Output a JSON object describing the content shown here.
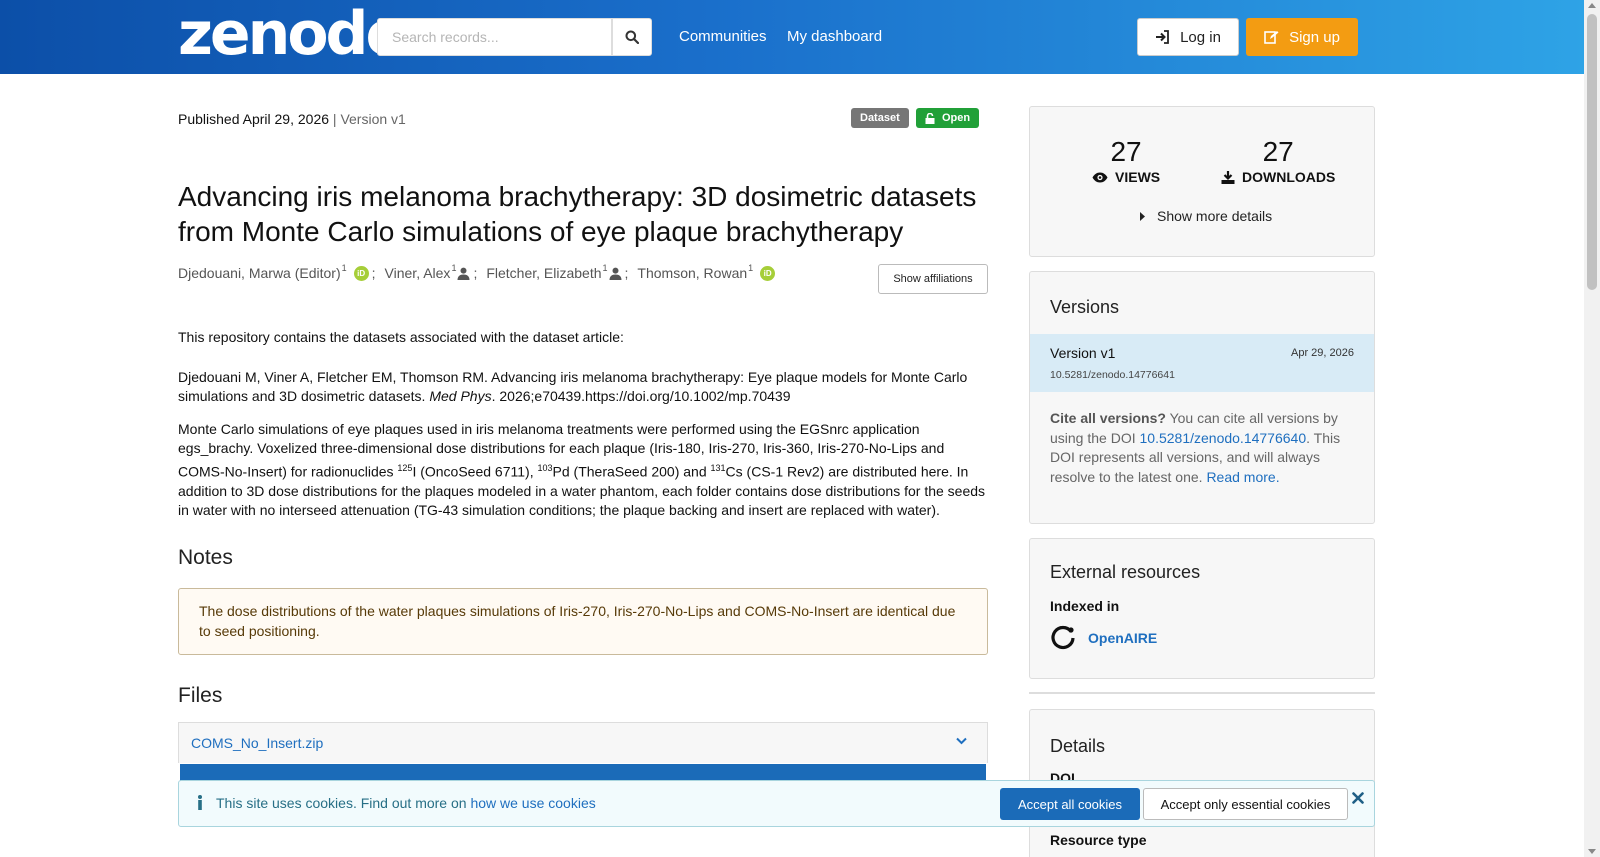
{
  "header": {
    "logo": "zenodo",
    "search_placeholder": "Search records...",
    "nav": [
      "Communities",
      "My dashboard"
    ],
    "login_label": "Log in",
    "signup_label": "Sign up",
    "signup_color": "#f39c12"
  },
  "record": {
    "published_prefix": "Published",
    "published_date": "April 29, 2026",
    "version": "| Version v1",
    "badges": {
      "type": "Dataset",
      "access": "Open"
    },
    "title": "Advancing iris melanoma brachytherapy: 3D dosimetric datasets from Monte Carlo simulations of eye plaque brachytherapy",
    "creators": [
      {
        "name": "Djedouani, Marwa (Editor)",
        "aff": "1",
        "icon": "orcid-icon"
      },
      {
        "name": "Viner, Alex",
        "aff": "1",
        "icon": "person-icon"
      },
      {
        "name": "Fletcher, Elizabeth",
        "aff": "1",
        "icon": "person-icon"
      },
      {
        "name": "Thomson, Rowan",
        "aff": "1",
        "icon": "orcid-icon"
      }
    ],
    "show_affiliations": "Show affiliations",
    "description": {
      "p1": "This repository contains the datasets associated with the dataset article:",
      "p2_a": "Djedouani M, Viner A, Fletcher EM, Thomson RM. Advancing iris melanoma brachytherapy: Eye plaque models for Monte Carlo simulations and 3D dosimetric datasets.",
      "p2_journal": "Med Phys",
      "p2_b": ". 2026;e70439.https://doi.org/10.1002/mp.70439",
      "p3_a": "Monte Carlo simulations of eye plaques used in iris melanoma treatments were performed using the EGSnrc application egs_brachy. Voxelized three-dimensional dose distributions for each plaque (Iris-180, Iris-270, Iris-360, Iris-270-No-Lips and COMS-No-Insert) for radionuclides ",
      "iso1_mass": "125",
      "iso1_rest": "I (OncoSeed 6711), ",
      "iso2_mass": "103",
      "iso2_rest": "Pd (TheraSeed 200) and ",
      "iso3_mass": "131",
      "iso3_rest": "Cs (CS-1 Rev2) are distributed here. In addition to 3D dose distributions for the plaques modeled in a water phantom, each folder contains dose distributions for the seeds in water with no interseed attenuation (TG-43 simulation conditions; the plaque backing and insert are replaced with water)."
    },
    "notes_heading": "Notes",
    "notes_text": "The dose distributions of the water plaques simulations of Iris-270, Iris-270-No-Lips and COMS-No-Insert are identical due to seed positioning.",
    "files_heading": "Files",
    "files": [
      {
        "name": "COMS_No_Insert.zip"
      }
    ]
  },
  "sidebar": {
    "views": {
      "count": "27",
      "label": "VIEWS"
    },
    "downloads": {
      "count": "27",
      "label": "DOWNLOADS"
    },
    "show_more": "Show more details",
    "versions": {
      "heading": "Versions",
      "active": {
        "name": "Version v1",
        "date": "Apr 29, 2026",
        "doi": "10.5281/zenodo.14776641"
      },
      "cite_bold": "Cite all versions?",
      "cite_a": " You can cite all versions by using the DOI ",
      "cite_doi": "10.5281/zenodo.14776640",
      "cite_b": ". This DOI represents all versions, and will always resolve to the latest one. ",
      "read_more": "Read more."
    },
    "external": {
      "heading": "External resources",
      "indexed_in": "Indexed in",
      "openaire": "OpenAIRE"
    },
    "details": {
      "heading": "Details",
      "doi_label": "DOI",
      "resource_type_label": "Resource type"
    }
  },
  "cookie": {
    "text": "This site uses cookies. Find out more on ",
    "link": "how we use cookies",
    "accept_all": "Accept all cookies",
    "accept_essential": "Accept only essential cookies"
  }
}
